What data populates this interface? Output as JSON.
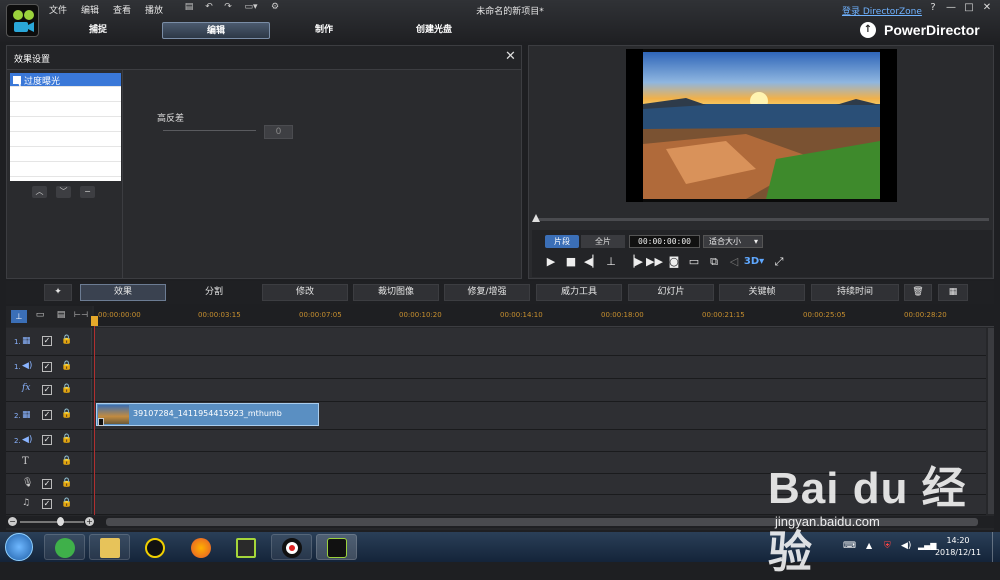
{
  "menu": [
    "文件",
    "编辑",
    "查看",
    "播放"
  ],
  "window": {
    "title": "未命名的新项目*",
    "directorzone": "登录 DirectorZone",
    "help": "?",
    "minimize": "—",
    "maximize": "□",
    "close": "✕"
  },
  "modes": [
    "捕捉",
    "编辑",
    "制作",
    "创建光盘"
  ],
  "brand": "PowerDirector",
  "effect_panel": {
    "title": "效果设置",
    "effects": [
      "过度曝光"
    ],
    "param_label": "高反差",
    "param_value": "0"
  },
  "preview": {
    "segment_clip": "片段",
    "segment_full": "全片",
    "timecode": "00:00:00:00",
    "fit": "适合大小",
    "scrub_progress": 0
  },
  "toolbar": [
    "效果",
    "分割",
    "修改",
    "裁切图像",
    "修复/增强",
    "威力工具",
    "幻灯片",
    "关键帧",
    "持续时间"
  ],
  "timeline": {
    "ticks": [
      "00:00:00:00",
      "00:00:03:15",
      "00:00:07:05",
      "00:00:10:20",
      "00:00:14:10",
      "00:00:18:00",
      "00:00:21:15",
      "00:00:25:05",
      "00:00:28:20"
    ],
    "tracks": [
      {
        "num": "1.",
        "icon": "video-track-icon"
      },
      {
        "num": "1.",
        "icon": "audio-track-icon"
      },
      {
        "num": "",
        "icon": "fx-track-icon",
        "label": "fx"
      },
      {
        "num": "2.",
        "icon": "video-track-icon"
      },
      {
        "num": "2.",
        "icon": "audio-track-icon"
      },
      {
        "num": "",
        "icon": "title-track-icon",
        "label": "T"
      },
      {
        "num": "",
        "icon": "voice-track-icon"
      },
      {
        "num": "",
        "icon": "music-track-icon"
      }
    ],
    "clip_name": "39107284_1411954415923_mthumb"
  },
  "taskbar": {
    "time": "14:20",
    "date": "2018/12/11"
  },
  "watermark": {
    "logo_text": "Bai du 经验",
    "url": "jingyan.baidu.com"
  }
}
